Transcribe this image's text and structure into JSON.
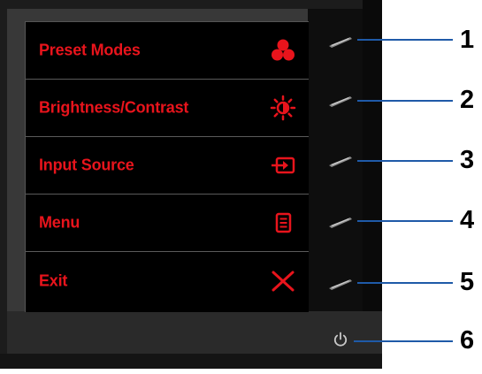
{
  "osd_menu": {
    "items": [
      {
        "label": "Preset Modes",
        "icon": "preset-modes-icon"
      },
      {
        "label": "Brightness/Contrast",
        "icon": "brightness-icon"
      },
      {
        "label": "Input Source",
        "icon": "input-source-icon"
      },
      {
        "label": "Menu",
        "icon": "menu-icon"
      },
      {
        "label": "Exit",
        "icon": "close-icon"
      }
    ]
  },
  "callouts": {
    "numbers": [
      "1",
      "2",
      "3",
      "4",
      "5",
      "6"
    ]
  },
  "colors": {
    "osd_text": "#e8141c",
    "osd_background": "#000000",
    "bezel": "#1c1c1c",
    "leader_line": "#1f5aa8"
  }
}
